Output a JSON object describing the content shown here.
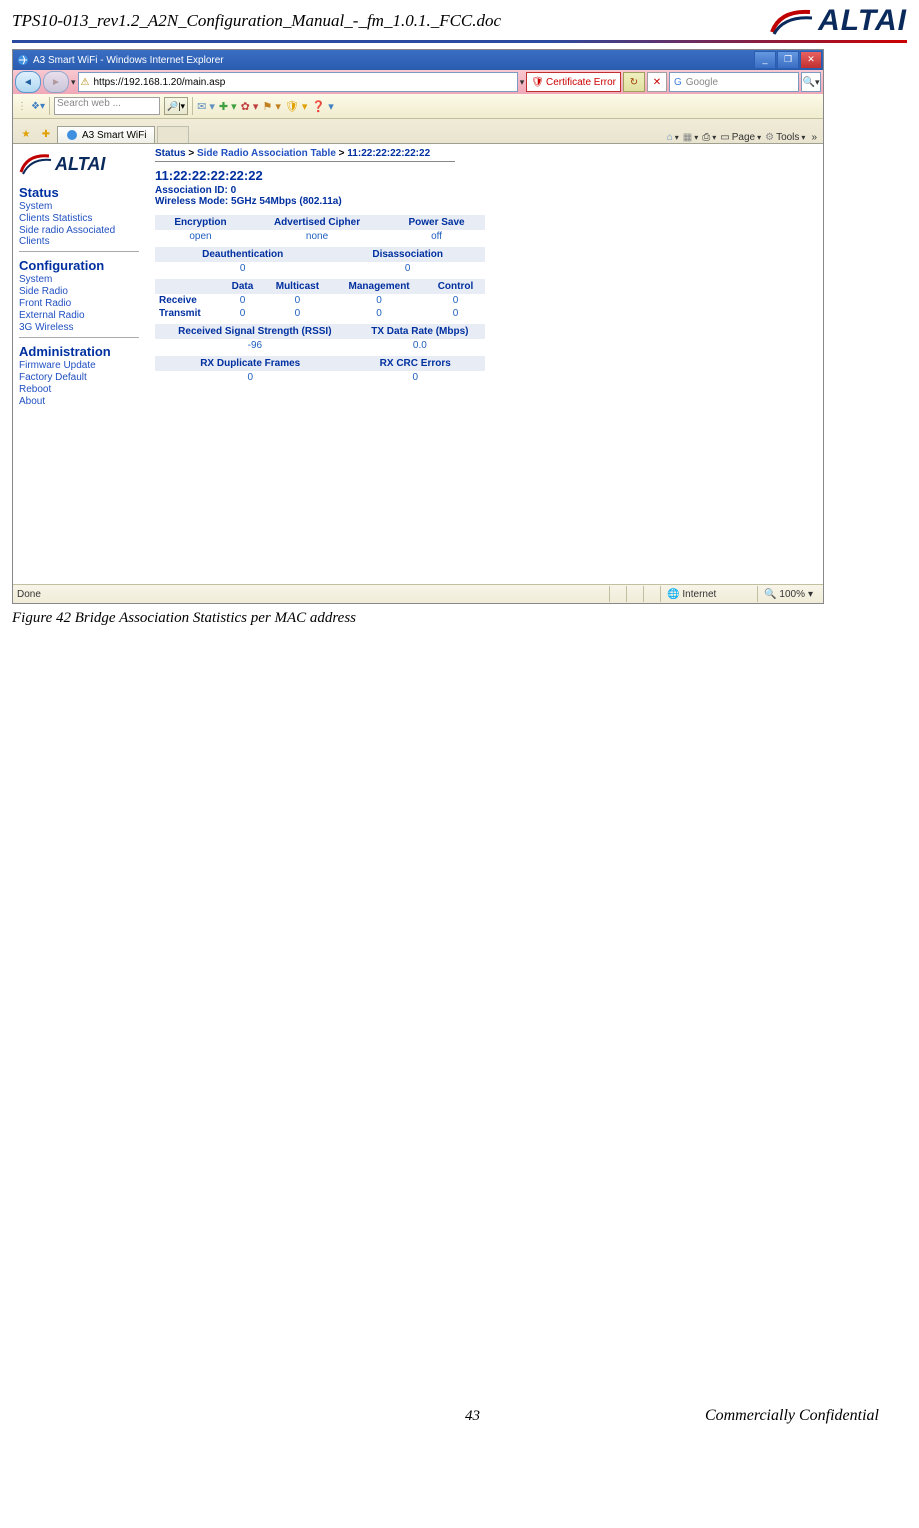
{
  "header": {
    "doc_title": "TPS10-013_rev1.2_A2N_Configuration_Manual_-_fm_1.0.1._FCC.doc",
    "logo_text": "ALTAI"
  },
  "browser": {
    "window_title": "A3 Smart WiFi - Windows Internet Explorer",
    "url": "https://192.168.1.20/main.asp",
    "cert_error": "Certificate Error",
    "search_placeholder": "Google",
    "searchweb_placeholder": "Search web ...",
    "tab_title": "A3 Smart WiFi",
    "toolbar_right": {
      "page": "Page",
      "tools": "Tools"
    },
    "status_left": "Done",
    "status_zone": "Internet",
    "status_zoom": "100%"
  },
  "sidebar": {
    "status_h": "Status",
    "status_items": [
      "System",
      "Clients Statistics",
      "Side radio Associated Clients"
    ],
    "config_h": "Configuration",
    "config_items": [
      "System",
      "Side Radio",
      "Front Radio",
      "External Radio",
      "3G Wireless"
    ],
    "admin_h": "Administration",
    "admin_items": [
      "Firmware Update",
      "Factory Default",
      "Reboot",
      "About"
    ]
  },
  "main": {
    "breadcrumb": {
      "root": "Status",
      "mid": "Side Radio Association Table",
      "leaf": "11:22:22:22:22:22"
    },
    "mac": "11:22:22:22:22:22",
    "assoc_id": "Association ID: 0",
    "wmode": "Wireless Mode: 5GHz 54Mbps (802.11a)",
    "t1": {
      "h": [
        "Encryption",
        "Advertised Cipher",
        "Power Save"
      ],
      "r": [
        "open",
        "none",
        "off"
      ]
    },
    "t2": {
      "h": [
        "Deauthentication",
        "Disassociation"
      ],
      "r": [
        "0",
        "0"
      ]
    },
    "t3": {
      "h": [
        "",
        "Data",
        "Multicast",
        "Management",
        "Control"
      ],
      "r1": [
        "Receive",
        "0",
        "0",
        "0",
        "0"
      ],
      "r2": [
        "Transmit",
        "0",
        "0",
        "0",
        "0"
      ]
    },
    "t4": {
      "h": [
        "Received Signal Strength (RSSI)",
        "TX Data Rate (Mbps)"
      ],
      "r": [
        "-96",
        "0.0"
      ]
    },
    "t5": {
      "h": [
        "RX Duplicate Frames",
        "RX CRC Errors"
      ],
      "r": [
        "0",
        "0"
      ]
    }
  },
  "caption": "Figure 42      Bridge Association Statistics per MAC address",
  "footer": {
    "page": "43",
    "conf": "Commercially Confidential"
  }
}
